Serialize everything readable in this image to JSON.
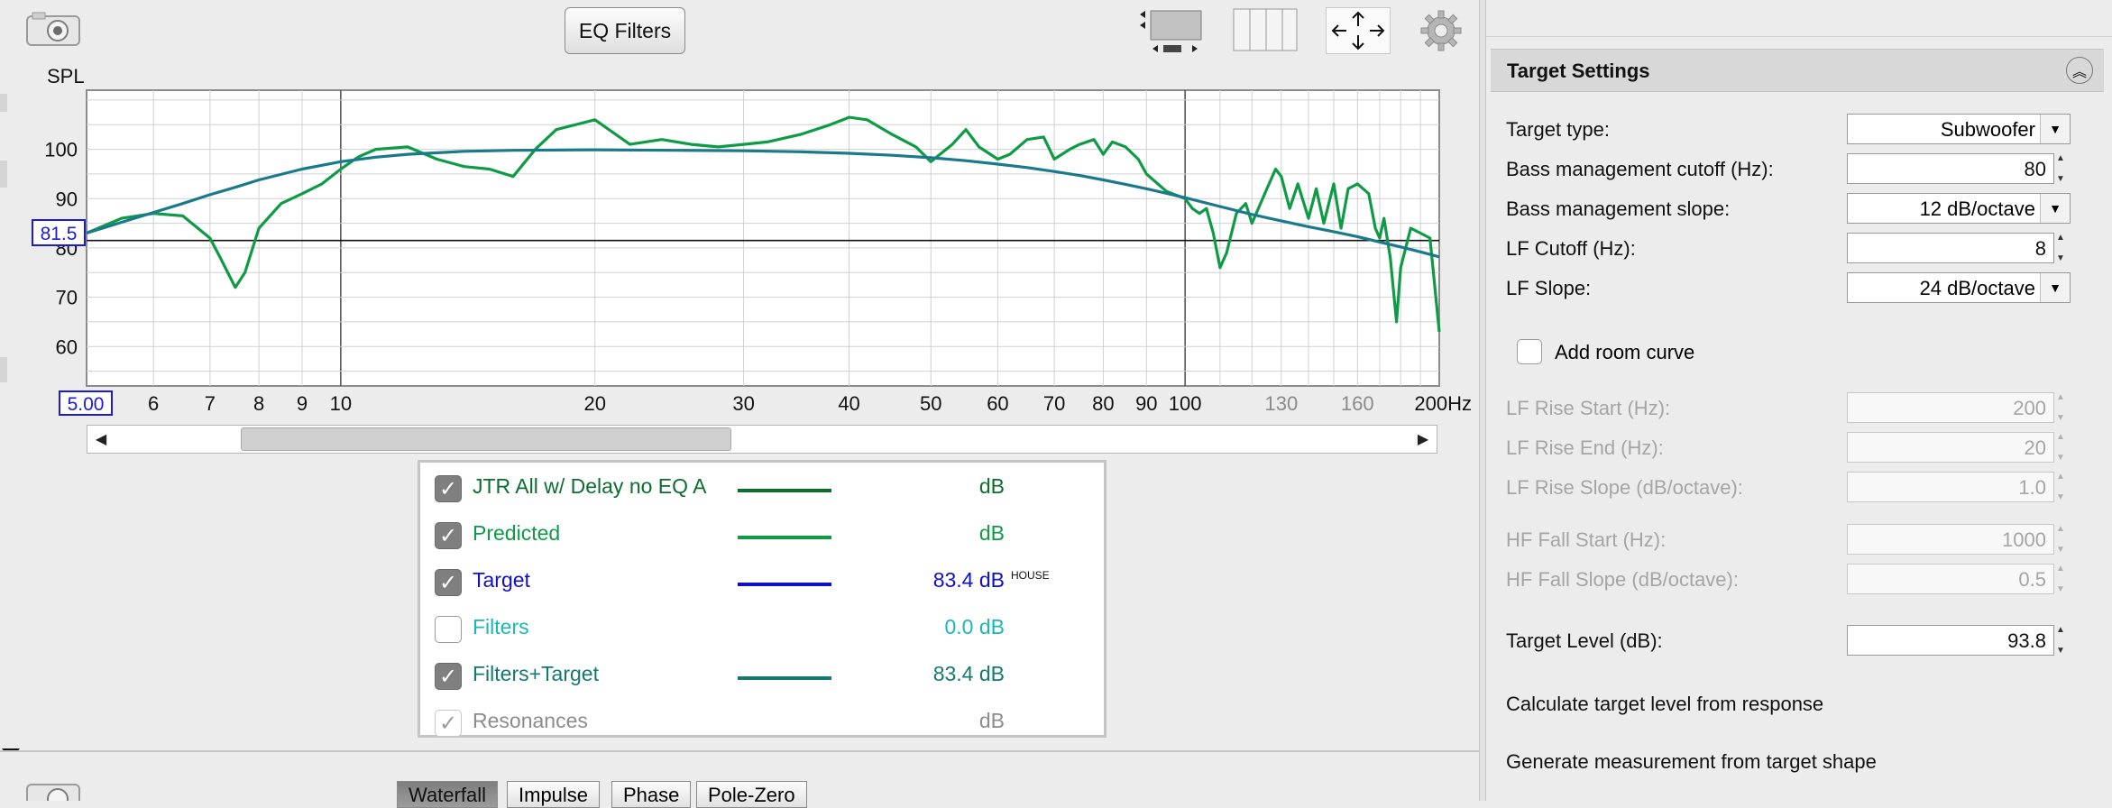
{
  "toolbar": {
    "eq_filters_label": "EQ Filters",
    "icons": [
      "camera-icon",
      "layout-stacked-icon",
      "layout-columns-icon",
      "move-arrows-icon",
      "gear-icon"
    ]
  },
  "chart": {
    "y_axis_title": "SPL",
    "cursor_level": "81.5",
    "x_start_label": "5.00",
    "y_ticks": [
      "100",
      "90",
      "80",
      "70",
      "60"
    ],
    "x_ticks": [
      "6",
      "7",
      "8",
      "9",
      "10",
      "20",
      "30",
      "40",
      "50",
      "60",
      "70",
      "80",
      "90",
      "100",
      "130",
      "160",
      "200Hz"
    ],
    "colors": {
      "measurement": "#0f9b45",
      "target": "#1a7a8c",
      "cursor": "#111111",
      "grid": "#d0d0d0"
    }
  },
  "chart_data": {
    "type": "line",
    "x_scale": "log",
    "xlim": [
      5,
      200
    ],
    "ylim": [
      52,
      112
    ],
    "xlabel": "",
    "ylabel": "SPL",
    "cursor_y": 81.5,
    "series": [
      {
        "name": "Predicted",
        "x": [
          5,
          5.5,
          6,
          6.5,
          7,
          7.2,
          7.5,
          7.7,
          8,
          8.5,
          9,
          9.5,
          10,
          10.5,
          11,
          12,
          13,
          14,
          15,
          16,
          17,
          18,
          20,
          22,
          24,
          26,
          28,
          30,
          32,
          35,
          38,
          40,
          42,
          45,
          48,
          50,
          53,
          55,
          57,
          60,
          62,
          65,
          68,
          70,
          73,
          75,
          78,
          80,
          82,
          85,
          88,
          90,
          95,
          100,
          102,
          104,
          106,
          108,
          110,
          112,
          115,
          118,
          120,
          125,
          128,
          130,
          133,
          136,
          140,
          143,
          146,
          150,
          153,
          156,
          160,
          165,
          168,
          170,
          172,
          175,
          178,
          180,
          185,
          190,
          195,
          200
        ],
        "y": [
          83,
          86,
          87,
          86.5,
          82,
          78,
          72,
          75,
          84,
          89,
          91,
          93,
          96,
          98.5,
          100,
          100.5,
          98,
          96.5,
          96,
          94.5,
          100,
          104,
          106,
          101,
          102,
          101,
          100.5,
          101,
          101.5,
          103,
          105,
          106.5,
          106,
          103,
          100.5,
          97.5,
          101,
          104,
          100.5,
          98,
          99,
          102,
          102.5,
          98,
          100,
          101,
          102,
          99,
          101.5,
          100.5,
          98,
          95,
          91.5,
          90,
          88,
          87,
          88,
          83,
          76,
          79,
          87,
          89,
          85,
          92,
          96,
          94.5,
          88,
          93,
          86,
          92,
          85,
          93,
          84,
          92,
          93,
          91,
          84,
          82,
          86,
          78,
          65,
          76,
          84,
          83,
          82,
          63
        ]
      },
      {
        "name": "Filters+Target",
        "x": [
          5,
          5.5,
          6,
          6.5,
          7,
          7.5,
          8,
          9,
          10,
          11,
          12,
          14,
          16,
          20,
          25,
          30,
          35,
          40,
          45,
          50,
          55,
          60,
          65,
          70,
          75,
          80,
          85,
          90,
          95,
          100,
          110,
          120,
          130,
          140,
          150,
          160,
          170,
          180,
          190,
          200
        ],
        "y": [
          83,
          85.2,
          87.2,
          89,
          90.8,
          92.3,
          93.8,
          96,
          97.5,
          98.4,
          99,
          99.6,
          99.8,
          99.9,
          99.8,
          99.7,
          99.5,
          99.2,
          98.8,
          98.3,
          97.7,
          97,
          96.3,
          95.5,
          94.7,
          93.8,
          92.9,
          92,
          91.1,
          90.2,
          88.4,
          86.8,
          85.5,
          84.3,
          83.3,
          82.3,
          81.2,
          80.2,
          79.2,
          78.2
        ]
      }
    ]
  },
  "legend": {
    "rows": [
      {
        "label": "JTR All w/ Delay no EQ A",
        "value": "dB",
        "checked": true,
        "color": "#0b6e2e",
        "line_color": "#0b6e2e"
      },
      {
        "label": "Predicted",
        "value": "dB",
        "checked": true,
        "color": "#0f9b45",
        "line_color": "#0f9b45"
      },
      {
        "label": "Target",
        "value": "83.4 dB",
        "sup": "HOUSE",
        "checked": true,
        "color": "#1010c8",
        "line_color": "#1010c8"
      },
      {
        "label": "Filters",
        "value": "0.0 dB",
        "checked": false,
        "color": "#18b8b8",
        "line_color": ""
      },
      {
        "label": "Filters+Target",
        "value": "83.4 dB",
        "checked": true,
        "color": "#137a70",
        "line_color": "#137a70"
      },
      {
        "label": "Resonances",
        "value": "dB",
        "checked": "light",
        "color": "#8c8c8c",
        "line_color": ""
      }
    ]
  },
  "bottom_tabs": [
    "Waterfall",
    "Impulse",
    "Phase",
    "Pole-Zero"
  ],
  "target_settings": {
    "title": "Target Settings",
    "target_type_label": "Target type:",
    "target_type_value": "Subwoofer",
    "bm_cutoff_label": "Bass management cutoff (Hz):",
    "bm_cutoff_value": "80",
    "bm_slope_label": "Bass management slope:",
    "bm_slope_value": "12 dB/octave",
    "lf_cutoff_label": "LF Cutoff (Hz):",
    "lf_cutoff_value": "8",
    "lf_slope_label": "LF Slope:",
    "lf_slope_value": "24 dB/octave",
    "room_curve_label": "Add room curve",
    "lf_rise_start_label": "LF Rise Start (Hz):",
    "lf_rise_start_value": "200",
    "lf_rise_end_label": "LF Rise End (Hz):",
    "lf_rise_end_value": "20",
    "lf_rise_slope_label": "LF Rise Slope (dB/octave):",
    "lf_rise_slope_value": "1.0",
    "hf_fall_start_label": "HF Fall Start (Hz):",
    "hf_fall_start_value": "1000",
    "hf_fall_slope_label": "HF Fall Slope (dB/octave):",
    "hf_fall_slope_value": "0.5",
    "target_level_label": "Target Level (dB):",
    "target_level_value": "93.8",
    "calc_level_label": "Calculate target level from response",
    "generate_label": "Generate measurement from target shape"
  }
}
